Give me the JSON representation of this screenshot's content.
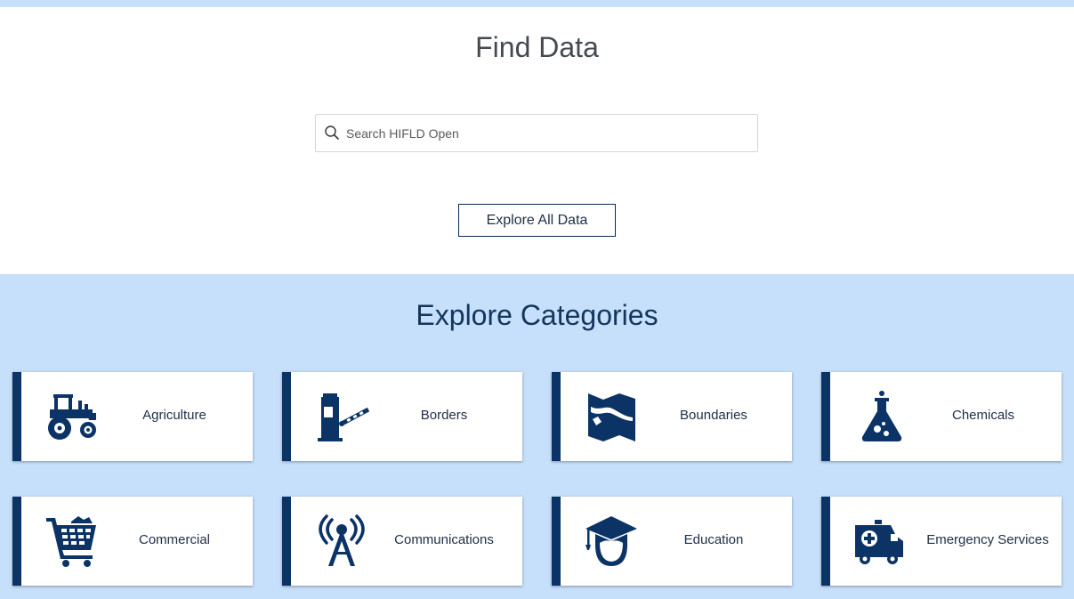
{
  "find_section": {
    "title": "Find Data",
    "search": {
      "placeholder": "Search HIFLD Open",
      "value": ""
    },
    "explore_all_label": "Explore All Data"
  },
  "categories_section": {
    "title": "Explore Categories",
    "items": [
      {
        "label": "Agriculture",
        "icon": "tractor-icon"
      },
      {
        "label": "Borders",
        "icon": "border-gate-icon"
      },
      {
        "label": "Boundaries",
        "icon": "map-icon"
      },
      {
        "label": "Chemicals",
        "icon": "flask-icon"
      },
      {
        "label": "Commercial",
        "icon": "shopping-cart-icon"
      },
      {
        "label": "Communications",
        "icon": "radio-tower-icon"
      },
      {
        "label": "Education",
        "icon": "graduate-icon"
      },
      {
        "label": "Emergency Services",
        "icon": "ambulance-icon"
      }
    ]
  },
  "colors": {
    "accent_navy": "#0b3366",
    "category_background": "#c6dffa",
    "title_text": "#13365e"
  }
}
